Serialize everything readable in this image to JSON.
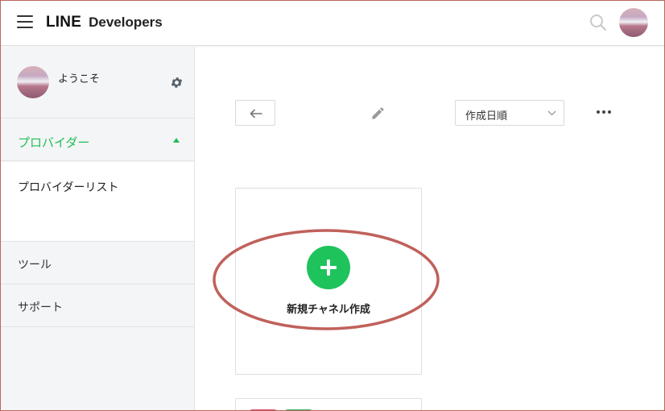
{
  "header": {
    "brand_line": "LINE",
    "brand_developers": "Developers",
    "search_icon": "search-icon",
    "avatar": "user-avatar"
  },
  "sidebar": {
    "welcome": "ようこそ",
    "settings_icon": "gear-icon",
    "provider_section": {
      "label": "プロバイダー",
      "expanded": true,
      "items": [
        {
          "label": "プロバイダーリスト"
        }
      ]
    },
    "nav_items": [
      {
        "label": "ツール"
      },
      {
        "label": "サポート"
      }
    ]
  },
  "main": {
    "toolbar": {
      "back_icon": "arrow-left-icon",
      "edit_icon": "pencil-icon",
      "sort_select_value": "作成日順",
      "more_icon": "more-horizontal-icon"
    },
    "new_channel_card": {
      "label": "新規チャネル作成",
      "icon": "plus-circle-icon"
    }
  },
  "colors": {
    "accent_green": "#1ec35c",
    "active_text_green": "#1fbe55",
    "annotation_red": "#c0615b",
    "sidebar_bg": "#f4f5f7"
  }
}
